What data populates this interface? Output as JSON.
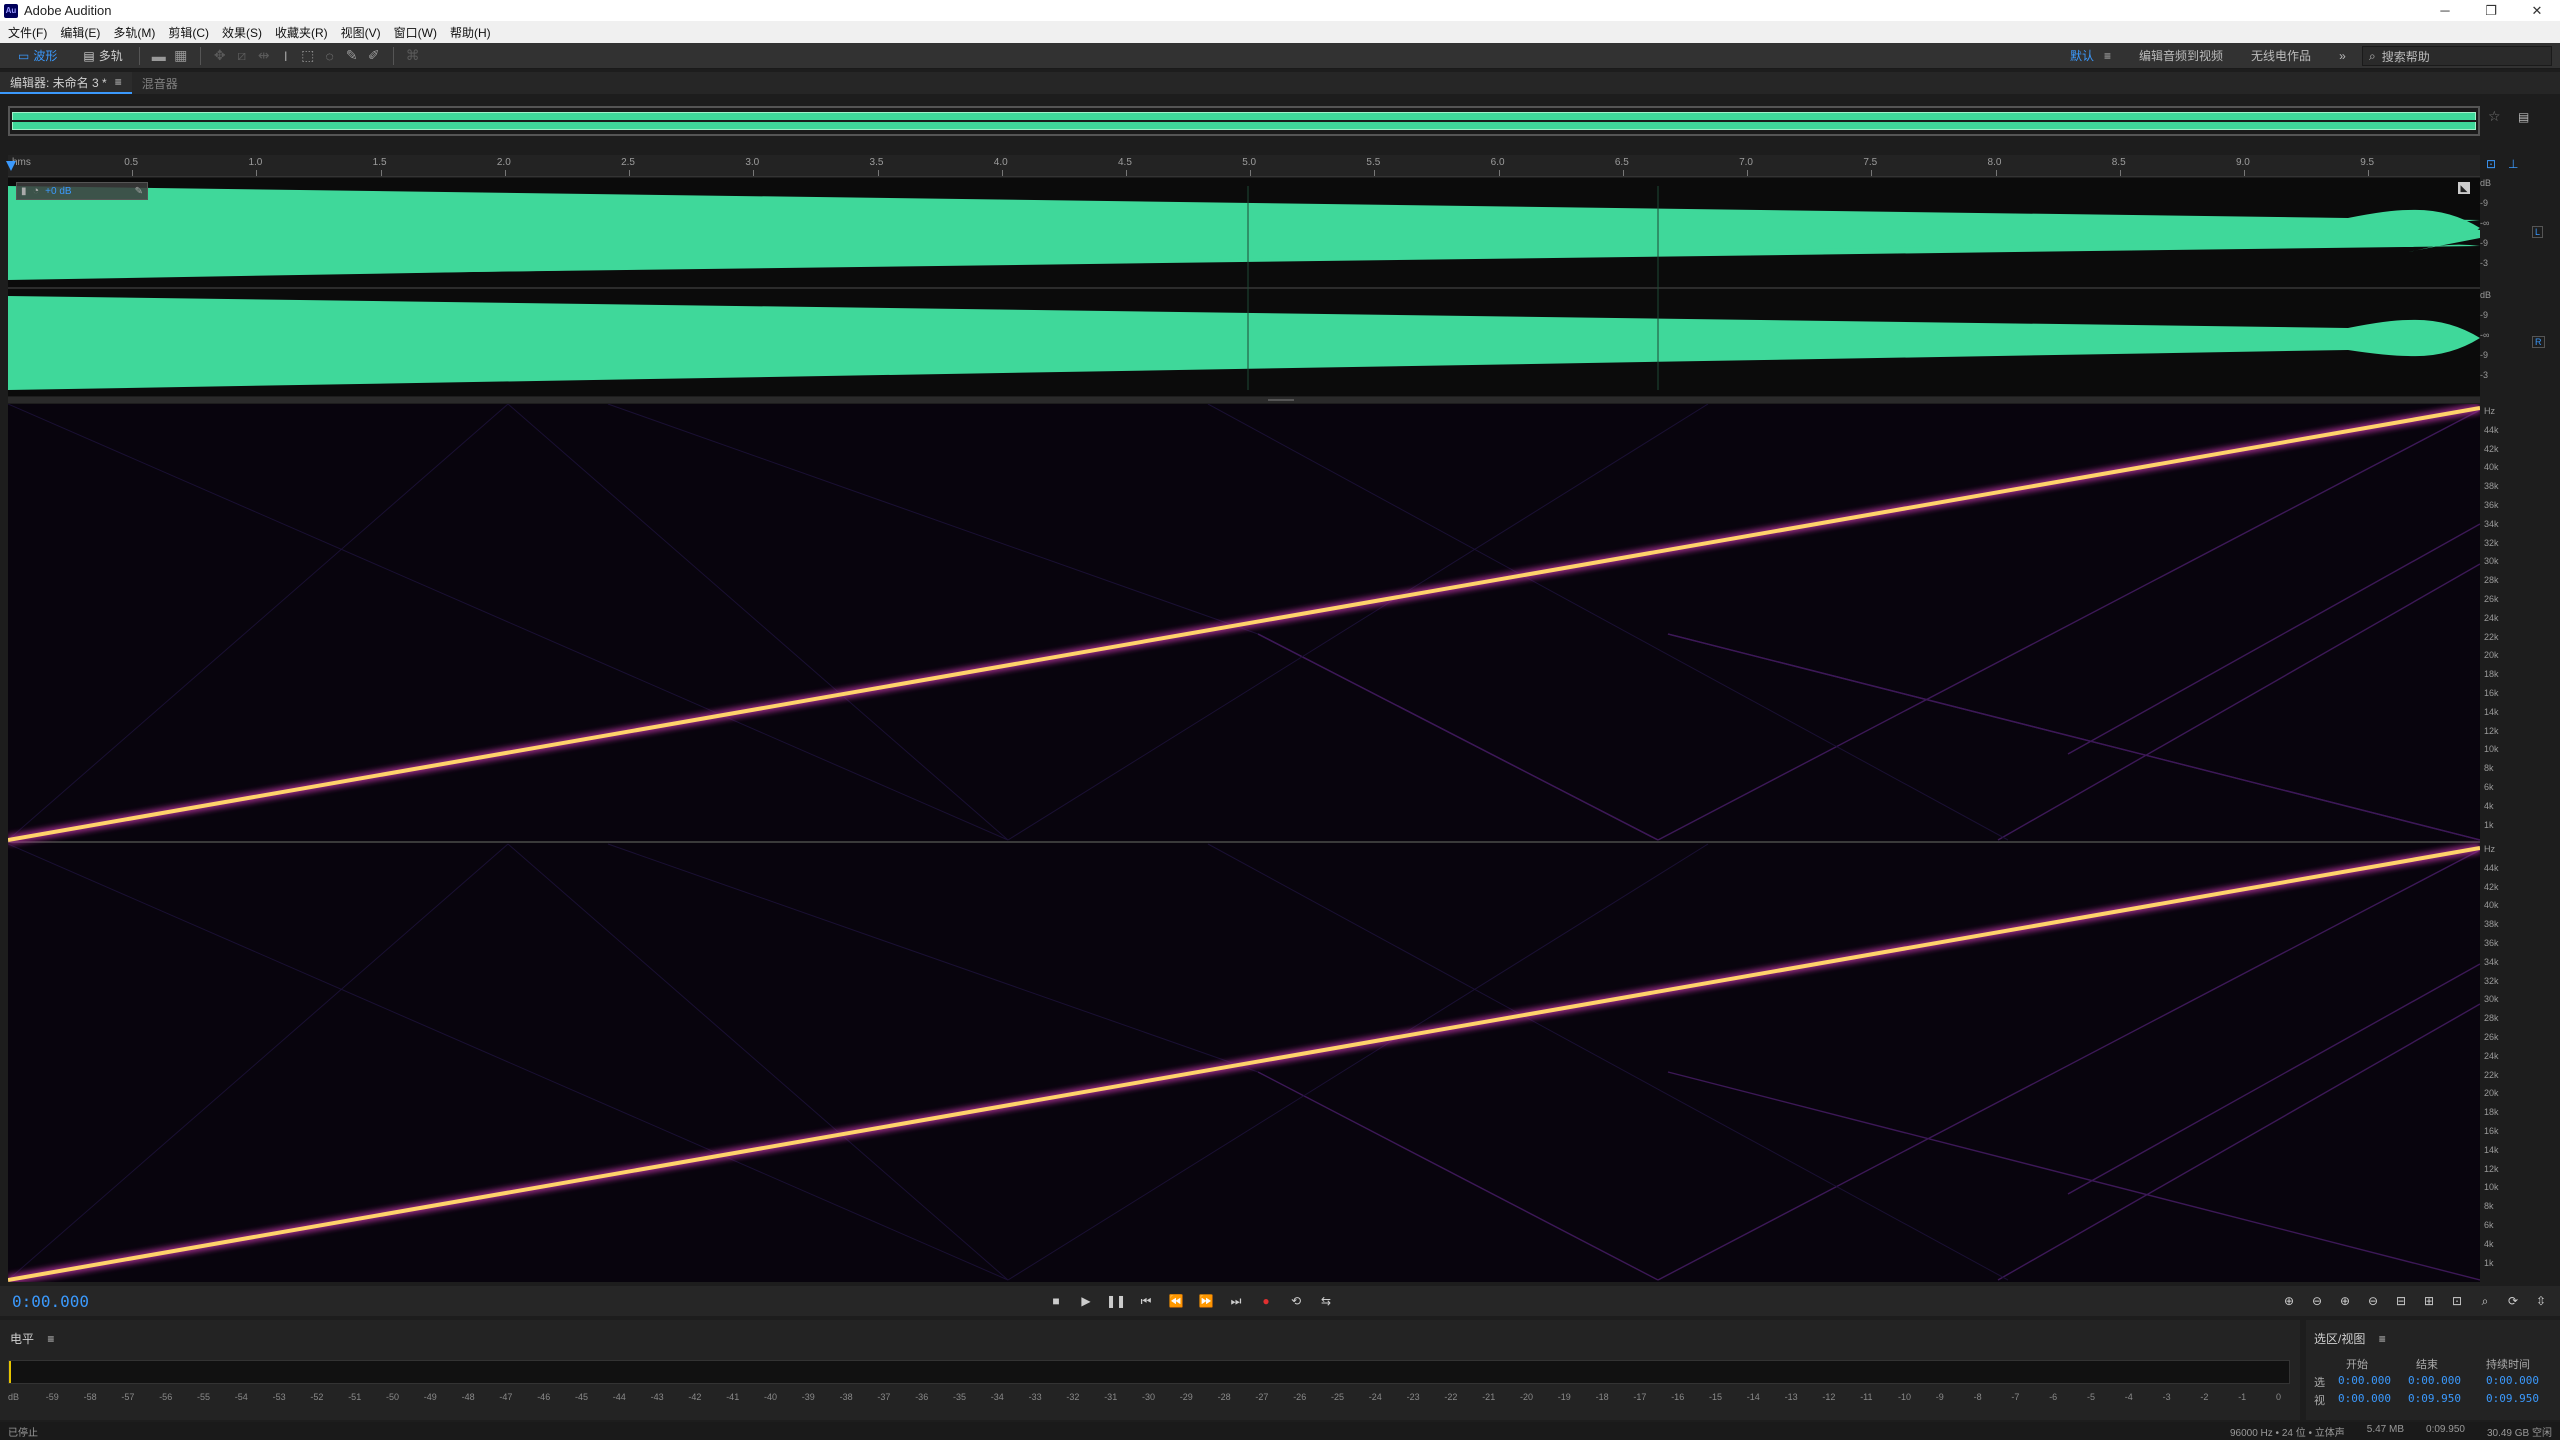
{
  "window": {
    "app_badge": "Au",
    "title": "Adobe Audition"
  },
  "menu": [
    "文件(F)",
    "编辑(E)",
    "多轨(M)",
    "剪辑(C)",
    "效果(S)",
    "收藏夹(R)",
    "视图(V)",
    "窗口(W)",
    "帮助(H)"
  ],
  "toolbar": {
    "waveform_tab": "波形",
    "multitrack_tab": "多轨",
    "workspaces": [
      "默认",
      "编辑音频到视频",
      "无线电作品"
    ],
    "search_placeholder": "搜索帮助"
  },
  "editor": {
    "tab_label": "编辑器: 未命名 3 *",
    "mixer_tab": "混音器",
    "ruler_unit": "hms",
    "ruler_ticks": [
      "0.5",
      "1.0",
      "1.5",
      "2.0",
      "2.5",
      "3.0",
      "3.5",
      "4.0",
      "4.5",
      "5.0",
      "5.5",
      "6.0",
      "6.5",
      "7.0",
      "7.5",
      "8.0",
      "8.5",
      "9.0",
      "9.5"
    ],
    "hud_gain": "+0 dB",
    "db_labels_ch1": [
      "dB",
      "-9",
      "-∞",
      "-9",
      "-3"
    ],
    "db_labels_ch2": [
      "dB",
      "-9",
      "-∞",
      "-9",
      "-3"
    ],
    "channel_labels": [
      "L",
      "R"
    ],
    "hz_labels": [
      "Hz",
      "44k",
      "42k",
      "40k",
      "38k",
      "36k",
      "34k",
      "32k",
      "30k",
      "28k",
      "26k",
      "24k",
      "22k",
      "20k",
      "18k",
      "16k",
      "14k",
      "12k",
      "10k",
      "8k",
      "6k",
      "4k",
      "1k"
    ]
  },
  "transport": {
    "current_time": "0:00.000"
  },
  "level_panel": {
    "title": "电平",
    "scale": [
      "dB",
      "-59",
      "-58",
      "-57",
      "-56",
      "-55",
      "-54",
      "-53",
      "-52",
      "-51",
      "-50",
      "-49",
      "-48",
      "-47",
      "-46",
      "-45",
      "-44",
      "-43",
      "-42",
      "-41",
      "-40",
      "-39",
      "-38",
      "-37",
      "-36",
      "-35",
      "-34",
      "-33",
      "-32",
      "-31",
      "-30",
      "-29",
      "-28",
      "-27",
      "-26",
      "-25",
      "-24",
      "-23",
      "-22",
      "-21",
      "-20",
      "-19",
      "-18",
      "-17",
      "-16",
      "-15",
      "-14",
      "-13",
      "-12",
      "-11",
      "-10",
      "-9",
      "-8",
      "-7",
      "-6",
      "-5",
      "-4",
      "-3",
      "-2",
      "-1",
      "0"
    ]
  },
  "selection_panel": {
    "title": "选区/视图",
    "col_start": "开始",
    "col_end": "结束",
    "col_duration": "持续时间",
    "row_selection": "选",
    "row_view": "视",
    "sel_start": "0:00.000",
    "sel_end": "0:00.000",
    "sel_duration": "0:00.000",
    "view_start": "0:00.000",
    "view_end": "0:09.950",
    "view_duration": "0:09.950"
  },
  "status": {
    "left": "已停止",
    "sample_info": "96000 Hz • 24 位 • 立体声",
    "file_size": "5.47 MB",
    "duration": "0:09.950",
    "free_space": "30.49 GB 空闲"
  },
  "colors": {
    "accent": "#3b99fc",
    "waveform": "#3fd89a",
    "sweep": "#ffd36b",
    "record": "#e03030"
  }
}
